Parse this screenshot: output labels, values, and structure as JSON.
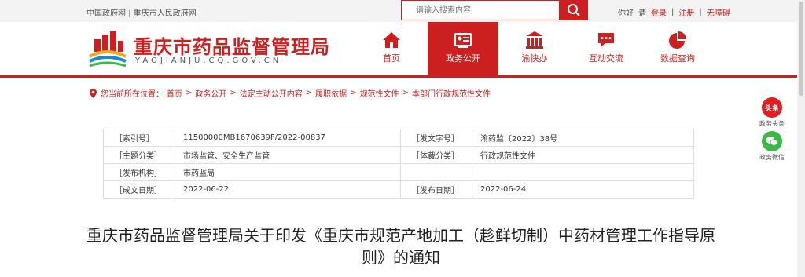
{
  "topbar": {
    "link_gov": "中国政府网",
    "link_sep": "|",
    "link_cq": "重庆市人民政府网",
    "search_placeholder": "请输入搜索内容",
    "hello": "你好",
    "please": "请",
    "login": "登录",
    "bar": "|",
    "register": "注册",
    "accessible": "无障碍"
  },
  "header": {
    "site_name": "重庆市药品监督管理局",
    "site_domain": "YAOJIANJU.CQ.GOV.CN"
  },
  "nav": [
    {
      "label": "首页",
      "icon": "home-icon"
    },
    {
      "label": "政务公开",
      "icon": "id-card-icon"
    },
    {
      "label": "渝快办",
      "icon": "government-building-icon"
    },
    {
      "label": "互动交流",
      "icon": "chat-bubble-icon"
    },
    {
      "label": "数据查询",
      "icon": "pie-chart-icon"
    }
  ],
  "breadcrumb": {
    "lead": "您当前所在位置：",
    "items": [
      "首页",
      "政务公开",
      "法定主动公开内容",
      "履职依据",
      "规范性文件",
      "本部门行政规范性文件"
    ],
    "sep": ">"
  },
  "side": {
    "toutiao_badge": "头条",
    "toutiao_caption": "政务头条",
    "wechat_caption": "政务微信"
  },
  "meta": {
    "k_index": "［索引号］",
    "v_index": "11500000MB1670639F/2022-00837",
    "k_docno": "［发文字号］",
    "v_docno": "渝药监〔2022〕38号",
    "k_topic": "［主题分类］",
    "v_topic": "市场监管、安全生产监管",
    "k_genre": "［体裁分类］",
    "v_genre": "行政规范性文件",
    "k_org": "［发布机构］",
    "v_org": "市药监局",
    "k_created": "［成文日期］",
    "v_created": "2022-06-22",
    "k_published": "［发布日期］",
    "v_published": "2022-06-24"
  },
  "title": "重庆市药品监督管理局关于印发《重庆市规范产地加工（趁鲜切制）中药材管理工作指导原则》的通知",
  "colors": {
    "accent": "#cc1f1f",
    "wechat": "#3bb84a"
  }
}
